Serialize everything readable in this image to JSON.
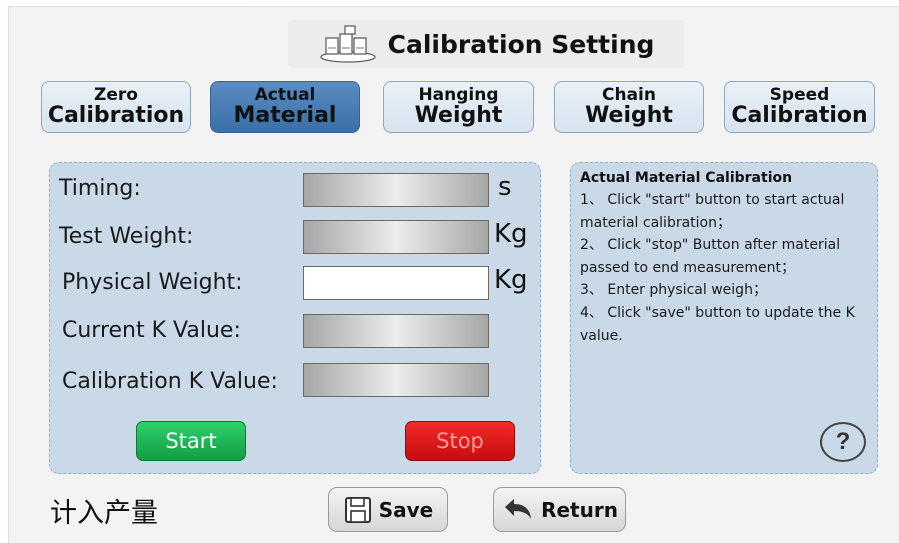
{
  "header": {
    "title": "Calibration Setting",
    "icon": "scale-weights-icon"
  },
  "tabs": [
    {
      "line1": "Zero",
      "line2": "Calibration",
      "active": false
    },
    {
      "line1": "Actual",
      "line2": "Material",
      "active": true
    },
    {
      "line1": "Hanging",
      "line2": "Weight",
      "active": false
    },
    {
      "line1": "Chain",
      "line2": "Weight",
      "active": false
    },
    {
      "line1": "Speed",
      "line2": "Calibration",
      "active": false
    }
  ],
  "form": {
    "timing_label": "Timing:",
    "timing_unit": "s",
    "test_weight_label": "Test Weight:",
    "test_weight_unit": "Kg",
    "physical_weight_label": "Physical Weight:",
    "physical_weight_unit": "Kg",
    "current_k_label": "Current K Value:",
    "calibration_k_label": "Calibration K Value:",
    "start_label": "Start",
    "stop_label": "Stop"
  },
  "info": {
    "title": "Actual Material Calibration",
    "body": "1、 Click \"start\" button to start actual material calibration；\n2、 Click \"stop\" Button after material passed to end measurement；\n3、 Enter physical weigh；\n4、 Click \"save\" button to update the K value."
  },
  "footer": {
    "text": "计入产量",
    "save_label": "Save",
    "return_label": "Return"
  },
  "colors": {
    "active_tab": "#3a6fa8",
    "panel": "#c9d9e8",
    "start": "#139c45",
    "stop": "#c70d0d"
  }
}
